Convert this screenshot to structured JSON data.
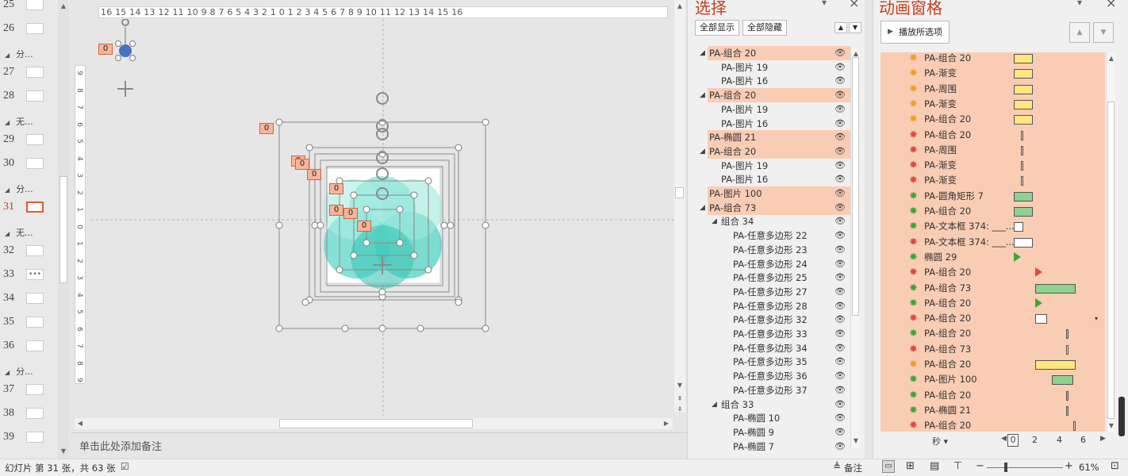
{
  "thumbnails": {
    "items": [
      {
        "num": "25",
        "type": "slide"
      },
      {
        "num": "26",
        "type": "slide"
      },
      {
        "section": "分..."
      },
      {
        "num": "27",
        "type": "slide"
      },
      {
        "num": "28",
        "type": "slide"
      },
      {
        "section": "无..."
      },
      {
        "num": "29",
        "type": "slide"
      },
      {
        "num": "30",
        "type": "slide"
      },
      {
        "section": "分..."
      },
      {
        "num": "31",
        "type": "slide",
        "active": true
      },
      {
        "section": "无..."
      },
      {
        "num": "32",
        "type": "slide"
      },
      {
        "num": "33",
        "type": "slide",
        "text": "•••"
      },
      {
        "num": "34",
        "type": "slide"
      },
      {
        "num": "35",
        "type": "slide"
      },
      {
        "num": "36",
        "type": "slide"
      },
      {
        "section": "分..."
      },
      {
        "num": "37",
        "type": "slide"
      },
      {
        "num": "38",
        "type": "slide"
      },
      {
        "num": "39",
        "type": "slide"
      }
    ]
  },
  "ruler": {
    "horizontal": "16 15 14 13 12 11 10 9 8 7 6 5 4 3 2 1 0 1 2 3 4 5 6 7 8 9 10 11 12 13 14 15 16",
    "vertical": [
      "9",
      "8",
      "7",
      "6",
      "5",
      "4",
      "3",
      "2",
      "1",
      "0",
      "1",
      "2",
      "3",
      "4",
      "5",
      "6",
      "7",
      "8",
      "9"
    ]
  },
  "canvas": {
    "tags": [
      "0",
      "0",
      "0",
      "0",
      "0",
      "0",
      "0",
      "0",
      "0"
    ]
  },
  "notes": {
    "placeholder": "单击此处添加备注"
  },
  "selection_pane": {
    "title": "选择",
    "show_all": "全部显示",
    "hide_all": "全部隐藏",
    "rows": [
      {
        "label": "PA-组合 20",
        "indent": 0,
        "expand": true,
        "hl": true
      },
      {
        "label": "PA-图片 19",
        "indent": 1
      },
      {
        "label": "PA-图片 16",
        "indent": 1
      },
      {
        "label": "PA-组合 20",
        "indent": 0,
        "expand": true,
        "hl": true
      },
      {
        "label": "PA-图片 19",
        "indent": 1
      },
      {
        "label": "PA-图片 16",
        "indent": 1
      },
      {
        "label": "PA-椭圆 21",
        "indent": 0,
        "hl": true
      },
      {
        "label": "PA-组合 20",
        "indent": 0,
        "expand": true,
        "hl": true
      },
      {
        "label": "PA-图片 19",
        "indent": 1
      },
      {
        "label": "PA-图片 16",
        "indent": 1
      },
      {
        "label": "PA-图片 100",
        "indent": 0,
        "hl": true
      },
      {
        "label": "PA-组合 73",
        "indent": 0,
        "expand": true,
        "hl": true
      },
      {
        "label": "组合 34",
        "indent": 1,
        "expand": true
      },
      {
        "label": "PA-任意多边形 22",
        "indent": 2
      },
      {
        "label": "PA-任意多边形 23",
        "indent": 2
      },
      {
        "label": "PA-任意多边形 24",
        "indent": 2
      },
      {
        "label": "PA-任意多边形 25",
        "indent": 2
      },
      {
        "label": "PA-任意多边形 27",
        "indent": 2
      },
      {
        "label": "PA-任意多边形 28",
        "indent": 2
      },
      {
        "label": "PA-任意多边形 32",
        "indent": 2
      },
      {
        "label": "PA-任意多边形 33",
        "indent": 2
      },
      {
        "label": "PA-任意多边形 34",
        "indent": 2
      },
      {
        "label": "PA-任意多边形 35",
        "indent": 2
      },
      {
        "label": "PA-任意多边形 36",
        "indent": 2
      },
      {
        "label": "PA-任意多边形 37",
        "indent": 2
      },
      {
        "label": "组合 33",
        "indent": 1,
        "expand": true
      },
      {
        "label": "PA-椭圆 10",
        "indent": 2
      },
      {
        "label": "PA-椭圆 9",
        "indent": 2
      },
      {
        "label": "PA-椭圆 7",
        "indent": 2
      }
    ]
  },
  "animation_pane": {
    "title": "动画窗格",
    "play_label": "播放所选项",
    "rows": [
      {
        "label": "PA-组合 20",
        "star": "#f0a020",
        "bar": "#ffe680",
        "offset": 0.0,
        "len": 0.08
      },
      {
        "label": "PA-渐变",
        "star": "#f0a020",
        "bar": "#ffe680",
        "offset": 0.0,
        "len": 0.08
      },
      {
        "label": "PA-周围",
        "star": "#f0a020",
        "bar": "#ffe680",
        "offset": 0.0,
        "len": 0.08
      },
      {
        "label": "PA-渐变",
        "star": "#f0a020",
        "bar": "#ffe680",
        "offset": 0.0,
        "len": 0.08
      },
      {
        "label": "PA-组合 20",
        "star": "#f0a020",
        "bar": "#ffe680",
        "offset": 0.0,
        "len": 0.08
      },
      {
        "label": "PA-组合 20",
        "star": "#e04848",
        "bar": "#f9cdb4",
        "offset": 0.03,
        "len": 0.01
      },
      {
        "label": "PA-周围",
        "star": "#e04848",
        "bar": "#f9cdb4",
        "offset": 0.03,
        "len": 0.01
      },
      {
        "label": "PA-渐变",
        "star": "#e04848",
        "bar": "#f9cdb4",
        "offset": 0.03,
        "len": 0.01
      },
      {
        "label": "PA-渐变",
        "star": "#e04848",
        "bar": "#f9cdb4",
        "offset": 0.03,
        "len": 0.01
      },
      {
        "label": "PA-圆角矩形 7",
        "star": "#3aa83a",
        "bar": "#8fd18f",
        "offset": 0.0,
        "len": 0.08
      },
      {
        "label": "PA-组合 20",
        "star": "#3aa83a",
        "bar": "#8fd18f",
        "offset": 0.0,
        "len": 0.08
      },
      {
        "label": "PA-文本框 374: ___...",
        "star": "#3aa83a",
        "bar": "#ffffff",
        "offset": 0.0,
        "len": 0.04
      },
      {
        "label": "PA-文本框 374: ___...",
        "star": "#e04848",
        "bar": "#ffffff",
        "offset": 0.0,
        "len": 0.08
      },
      {
        "label": "椭圆 29",
        "star": "#3aa83a",
        "tri": "#3aa83a",
        "offset": 0.0
      },
      {
        "label": "PA-组合 20",
        "star": "#e04848",
        "tri": "#ffffff",
        "offset": 0.09
      },
      {
        "label": "PA-组合 73",
        "star": "#3aa83a",
        "bar": "#8fd18f",
        "offset": 0.09,
        "len": 0.17
      },
      {
        "label": "PA-组合 20",
        "star": "#3aa83a",
        "tri": "#3aa83a",
        "offset": 0.09
      },
      {
        "label": "PA-组合 20",
        "star": "#e04848",
        "bar": "#ffffff",
        "offset": 0.09,
        "len": 0.05
      },
      {
        "label": "PA-组合 20",
        "star": "#3aa83a",
        "bar": "#8fd18f",
        "offset": 0.22,
        "len": 0.01
      },
      {
        "label": "PA-组合 73",
        "star": "#e04848",
        "bar": "#f9cdb4",
        "offset": 0.22,
        "len": 0.01
      },
      {
        "label": "PA-组合 20",
        "star": "#f0a020",
        "bar": "#ffe680",
        "offset": 0.09,
        "len": 0.17
      },
      {
        "label": "PA-图片 100",
        "star": "#3aa83a",
        "bar": "#8fd18f",
        "offset": 0.16,
        "len": 0.09
      },
      {
        "label": "PA-组合 20",
        "star": "#3aa83a",
        "bar": "#8fd18f",
        "offset": 0.22,
        "len": 0.01
      },
      {
        "label": "PA-椭圆 21",
        "star": "#3aa83a",
        "bar": "#8fd18f",
        "offset": 0.22,
        "len": 0.01
      },
      {
        "label": "PA-组合 20",
        "star": "#e04848",
        "bar": "#f9cdb4",
        "offset": 0.25,
        "len": 0.01
      }
    ],
    "timeline_unit": "秒",
    "timeline_ticks": [
      "0",
      "2",
      "4",
      "6"
    ]
  },
  "statusbar": {
    "slide_info": "幻灯片 第 31 张，共 63 张",
    "notes_label": "备注",
    "zoom": "61%"
  },
  "colors": {
    "accent": "#c43e1c",
    "highlight": "#f9cdb4"
  }
}
